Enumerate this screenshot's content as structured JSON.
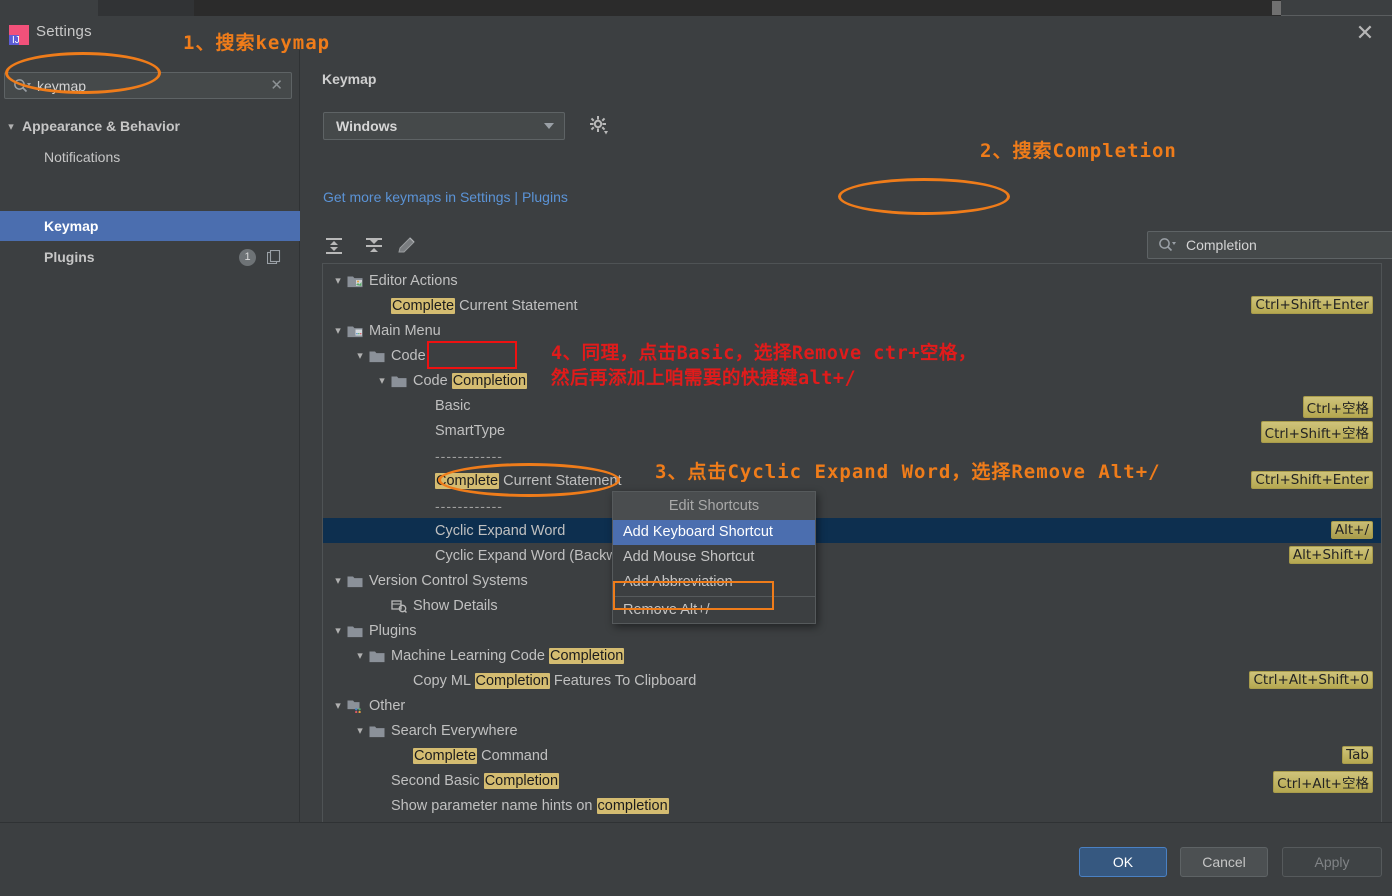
{
  "window": {
    "title": "Settings",
    "close_icon": "close-icon"
  },
  "sidebar": {
    "search": {
      "value": "keymap",
      "placeholder": "",
      "icon": "search-icon",
      "clear_icon": "clear-icon"
    },
    "items": [
      {
        "label": "Appearance & Behavior",
        "chevron": "chevron-down",
        "indent": 0,
        "selected": false
      },
      {
        "label": "Notifications",
        "chevron": "",
        "indent": 1,
        "selected": false
      },
      {
        "label": "Keymap",
        "chevron": "",
        "indent": 1,
        "selected": true
      },
      {
        "label": "Plugins",
        "chevron": "",
        "indent": 1,
        "selected": false,
        "badge": "1"
      }
    ],
    "help_label": "?"
  },
  "keymap_page": {
    "title": "Keymap",
    "scheme_value": "Windows",
    "gear_icon": "gear-icon",
    "plugins_link": "Get more keymaps in Settings | Plugins",
    "toolbar": [
      {
        "icon": "expand-all-icon"
      },
      {
        "icon": "collapse-all-icon"
      },
      {
        "icon": "edit-pencil-icon"
      }
    ],
    "search": {
      "value": "Completion",
      "placeholder": "",
      "icon": "search-icon",
      "clear_icon": "clear-icon"
    },
    "filter_button_icon": "find-by-shortcut-icon",
    "tree": [
      {
        "id": "editor-actions",
        "indent": 0,
        "arrow": "v",
        "icon": "editor-actions-icon",
        "text": "Editor Actions",
        "highlight": "",
        "shortcut": ""
      },
      {
        "id": "complete-current-statement-1",
        "indent": 2,
        "arrow": "",
        "icon": "",
        "text": "Complete Current Statement",
        "highlight": "Complete",
        "shortcut": "Ctrl+Shift+Enter"
      },
      {
        "id": "main-menu",
        "indent": 0,
        "arrow": "v",
        "icon": "main-menu-icon",
        "text": "Main Menu",
        "highlight": "",
        "shortcut": ""
      },
      {
        "id": "code",
        "indent": 1,
        "arrow": "v",
        "icon": "folder-icon",
        "text": "Code",
        "highlight": "",
        "shortcut": ""
      },
      {
        "id": "code-completion",
        "indent": 2,
        "arrow": "v",
        "icon": "folder-icon",
        "text": "Code Completion",
        "highlight": "Completion",
        "shortcut": ""
      },
      {
        "id": "basic",
        "indent": 4,
        "arrow": "",
        "icon": "",
        "text": "Basic",
        "highlight": "",
        "shortcut": "Ctrl+空格"
      },
      {
        "id": "smarttype",
        "indent": 4,
        "arrow": "",
        "icon": "",
        "text": "SmartType",
        "highlight": "",
        "shortcut": "Ctrl+Shift+空格"
      },
      {
        "id": "separator-1",
        "indent": 4,
        "arrow": "",
        "icon": "",
        "text": "------------",
        "highlight": "",
        "shortcut": "",
        "is_separator": true
      },
      {
        "id": "complete-current-statement-2",
        "indent": 4,
        "arrow": "",
        "icon": "",
        "text": "Complete Current Statement",
        "highlight": "Complete",
        "shortcut": "Ctrl+Shift+Enter"
      },
      {
        "id": "separator-2",
        "indent": 4,
        "arrow": "",
        "icon": "",
        "text": "------------",
        "highlight": "",
        "shortcut": "",
        "is_separator": true
      },
      {
        "id": "cyclic-expand-word",
        "indent": 4,
        "arrow": "",
        "icon": "",
        "text": "Cyclic Expand Word",
        "highlight": "",
        "shortcut": "Alt+/",
        "selected": true
      },
      {
        "id": "cyclic-expand-word-backward",
        "indent": 4,
        "arrow": "",
        "icon": "",
        "text": "Cyclic Expand Word (Backward)",
        "highlight": "",
        "shortcut": "Alt+Shift+/"
      },
      {
        "id": "version-control-systems",
        "indent": 0,
        "arrow": "v",
        "icon": "folder-icon",
        "text": "Version Control Systems",
        "highlight": "",
        "shortcut": ""
      },
      {
        "id": "show-details",
        "indent": 2,
        "arrow": "",
        "icon": "show-details-icon",
        "text": "Show Details",
        "highlight": "",
        "shortcut": ""
      },
      {
        "id": "plugins-node",
        "indent": 0,
        "arrow": "v",
        "icon": "folder-icon",
        "text": "Plugins",
        "highlight": "",
        "shortcut": ""
      },
      {
        "id": "ml-code-completion",
        "indent": 1,
        "arrow": "v",
        "icon": "folder-icon",
        "text": "Machine Learning Code Completion",
        "highlight": "Completion",
        "shortcut": ""
      },
      {
        "id": "copy-ml-completion",
        "indent": 3,
        "arrow": "",
        "icon": "",
        "text": "Copy ML Completion Features To Clipboard",
        "highlight": "Completion",
        "shortcut": "Ctrl+Alt+Shift+0"
      },
      {
        "id": "other",
        "indent": 0,
        "arrow": "v",
        "icon": "other-icon",
        "text": "Other",
        "highlight": "",
        "shortcut": ""
      },
      {
        "id": "search-everywhere",
        "indent": 1,
        "arrow": "v",
        "icon": "folder-icon",
        "text": "Search Everywhere",
        "highlight": "",
        "shortcut": ""
      },
      {
        "id": "complete-command",
        "indent": 3,
        "arrow": "",
        "icon": "",
        "text": "Complete Command",
        "highlight": "Complete",
        "shortcut": "Tab"
      },
      {
        "id": "second-basic-completion",
        "indent": 2,
        "arrow": "",
        "icon": "",
        "text": "Second Basic Completion",
        "highlight": "Completion",
        "shortcut": "Ctrl+Alt+空格"
      },
      {
        "id": "show-param-hints",
        "indent": 2,
        "arrow": "",
        "icon": "",
        "text": "Show parameter name hints on completion",
        "highlight": "completion",
        "shortcut": ""
      }
    ]
  },
  "context_menu": {
    "header": "Edit Shortcuts",
    "items": [
      {
        "label": "Add Keyboard Shortcut",
        "highlighted": true
      },
      {
        "label": "Add Mouse Shortcut",
        "highlighted": false
      },
      {
        "label": "Add Abbreviation",
        "highlighted": false
      },
      {
        "label": "Remove Alt+/",
        "highlighted": false,
        "boxed": true
      }
    ]
  },
  "footer": {
    "ok": "OK",
    "cancel": "Cancel",
    "apply": "Apply"
  },
  "annotations": [
    {
      "id": "anno-1",
      "text": "1、搜索keymap",
      "color": "#ef7c1a"
    },
    {
      "id": "anno-2",
      "text": "2、搜索Completion",
      "color": "#ef7c1a"
    },
    {
      "id": "anno-3",
      "text": "3、点击Cyclic Expand Word，选择Remove Alt+/",
      "color": "#ef7c1a"
    },
    {
      "id": "anno-4-line1",
      "text": "4、同理，点击Basic，选择Remove ctr+空格，",
      "color": "#e01b1b"
    },
    {
      "id": "anno-4-line2",
      "text": "然后再添加上咱需要的快捷键alt+/",
      "color": "#e01b1b"
    }
  ],
  "colors": {
    "accent_blue": "#4b6eaf",
    "selection_navy": "#0d2f4f",
    "highlight_yellow": "#d4bc71",
    "annotation_orange": "#ef7c1a",
    "annotation_red": "#e01b1b",
    "link_blue": "#5b93d6"
  }
}
